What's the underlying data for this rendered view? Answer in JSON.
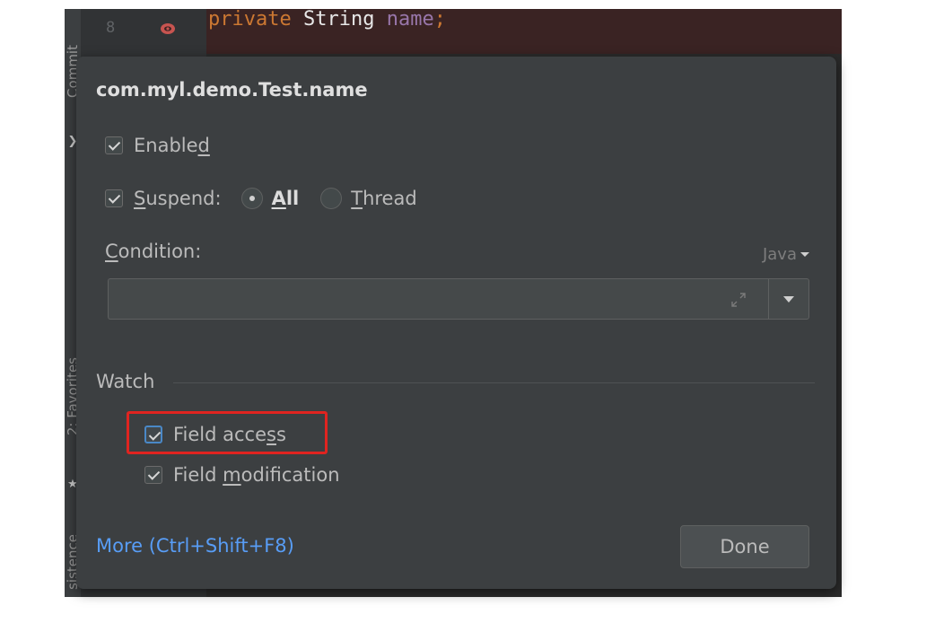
{
  "editor": {
    "line_number": "8",
    "code": {
      "keyword": "private",
      "type": "String",
      "field": "name",
      "punct": ";"
    },
    "side_tabs": {
      "commit": "Commit",
      "favorites": "2: Favorites",
      "persistence": "sistence"
    }
  },
  "popup": {
    "title": "com.myl.demo.Test.name",
    "enabled": {
      "label_pre": "Enable",
      "label_mn": "d",
      "label_post": "",
      "checked": true
    },
    "suspend": {
      "label_mn": "S",
      "label_post": "uspend:",
      "checked": true,
      "options": [
        {
          "mn": "A",
          "rest": "ll",
          "selected": true
        },
        {
          "mn": "T",
          "rest": "hread",
          "selected": false
        }
      ]
    },
    "condition": {
      "label_mn": "C",
      "label_post": "ondition:",
      "value": "",
      "language": "Java"
    },
    "watch": {
      "label": "Watch",
      "field_access": {
        "pre": "Field acce",
        "mn": "s",
        "post": "s",
        "checked": true
      },
      "field_modification": {
        "pre": "Field ",
        "mn": "m",
        "post": "odification",
        "checked": true
      }
    },
    "more_link": "More (Ctrl+Shift+F8)",
    "done_label": "Done"
  },
  "colors": {
    "highlight": "#e02420",
    "link": "#589df6",
    "popup_bg": "#3c3f41"
  },
  "icons": [
    "breakpoint-field-icon",
    "expand-icon",
    "dropdown-arrow-icon",
    "checkmark-icon",
    "star-icon",
    "arrow-icon"
  ]
}
